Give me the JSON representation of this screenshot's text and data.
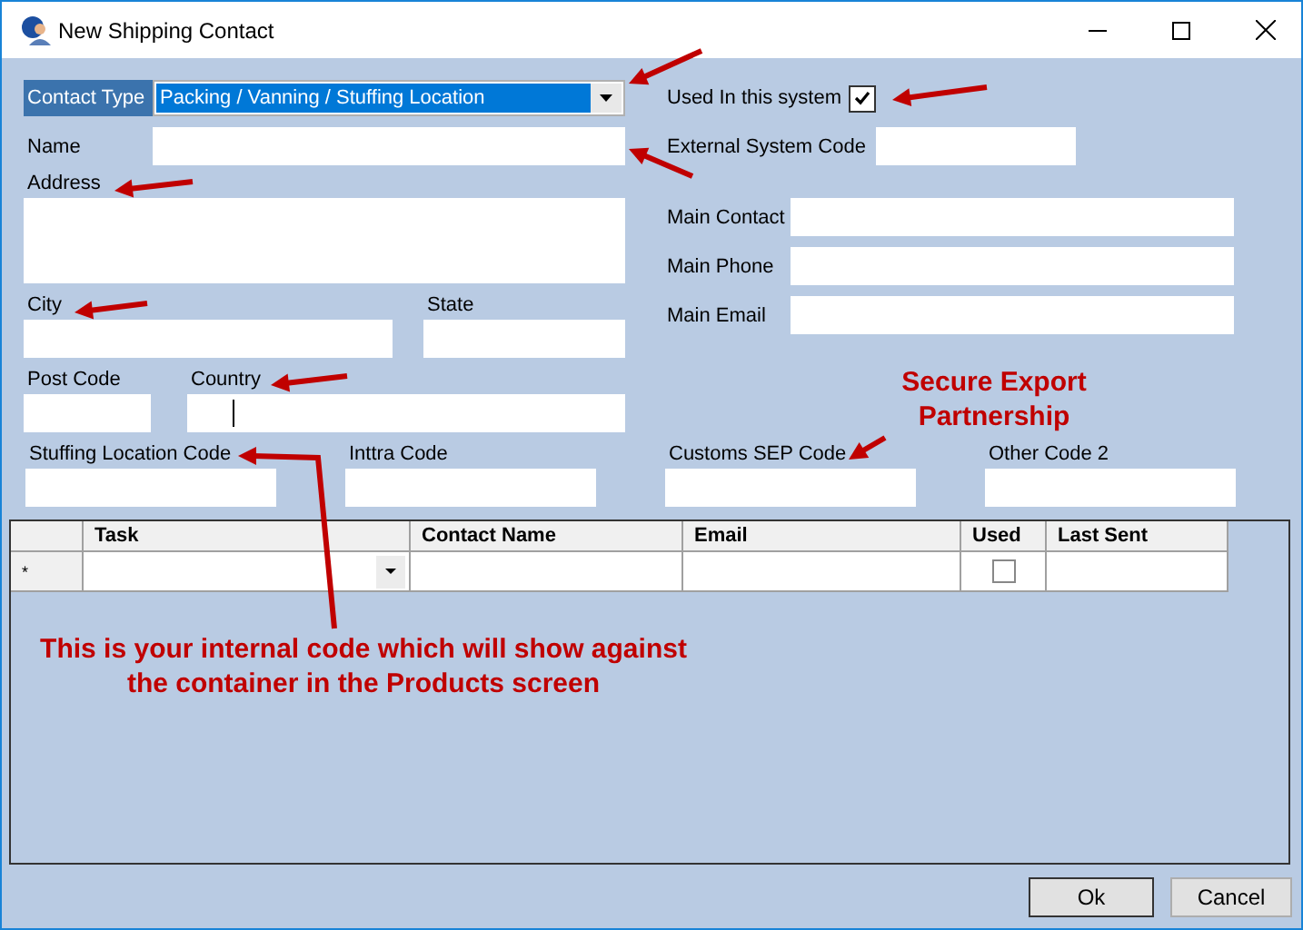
{
  "window": {
    "title": "New Shipping Contact"
  },
  "form": {
    "contact_type": {
      "label": "Contact Type",
      "value": "Packing / Vanning / Stuffing Location"
    },
    "used_in_system": {
      "label": "Used In this system",
      "checked": true
    },
    "name": {
      "label": "Name",
      "focused": false
    },
    "external_system_code": {
      "label": "External System Code",
      "focused": false
    },
    "address": {
      "label": "Address",
      "focused": false
    },
    "main_contact": {
      "label": "Main Contact",
      "focused": false
    },
    "main_phone": {
      "label": "Main Phone",
      "focused": false
    },
    "main_email": {
      "label": "Main Email",
      "focused": false
    },
    "city": {
      "label": "City",
      "focused": false
    },
    "state": {
      "label": "State",
      "focused": false
    },
    "post_code": {
      "label": "Post Code",
      "focused": false
    },
    "country": {
      "label": "Country",
      "focused": true
    },
    "stuffing_location_code": {
      "label": "Stuffing Location Code",
      "focused": false
    },
    "inttra_code": {
      "label": "Inttra Code",
      "focused": false
    },
    "customs_sep_code": {
      "label": "Customs SEP Code",
      "focused": false
    },
    "other_code_2": {
      "label": "Other Code 2",
      "focused": false
    }
  },
  "grid": {
    "columns": [
      "Task",
      "Contact Name",
      "Email",
      "Used",
      "Last Sent"
    ],
    "new_row": {
      "marker": "*",
      "used_checked": false
    }
  },
  "annotations": [
    {
      "text": "Secure Export Partnership"
    },
    {
      "text": "This is your internal code which will show against the container in the Products screen"
    }
  ],
  "buttons": [
    "Ok",
    "Cancel"
  ]
}
